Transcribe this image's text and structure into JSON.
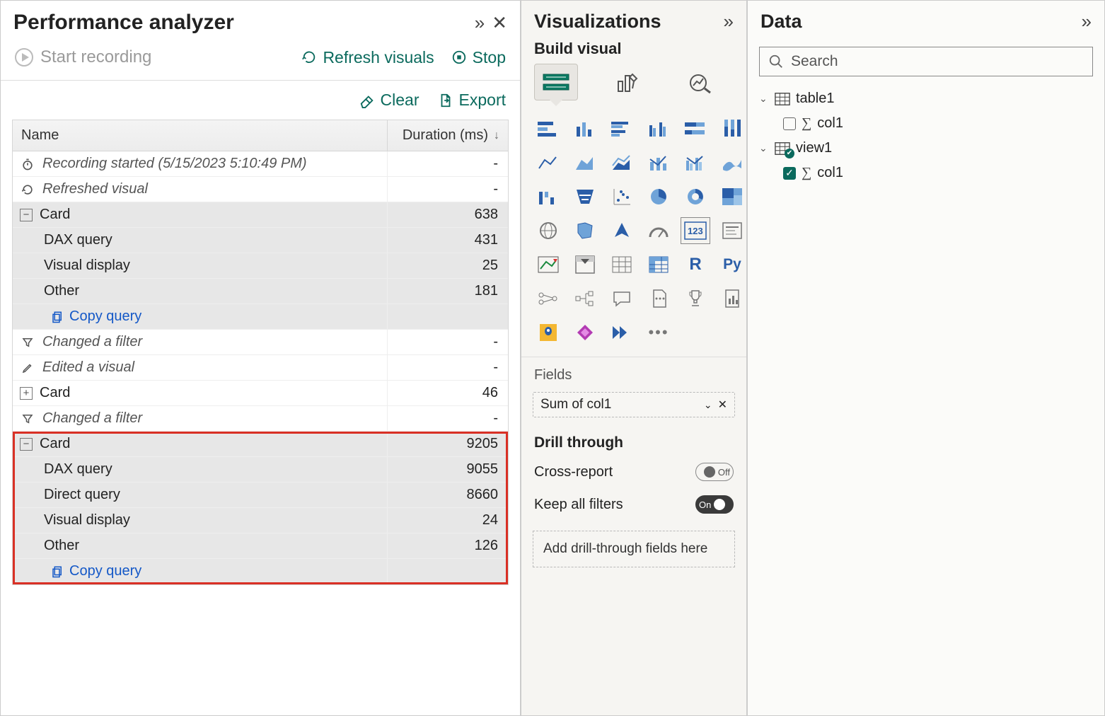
{
  "perf": {
    "title": "Performance analyzer",
    "start": "Start recording",
    "refresh": "Refresh visuals",
    "stop": "Stop",
    "clear": "Clear",
    "export": "Export",
    "col_name": "Name",
    "col_dur": "Duration (ms)",
    "rows": {
      "rec_started": "Recording started (5/15/2023 5:10:49 PM)",
      "refreshed": "Refreshed visual",
      "card1": "Card",
      "card1_dur": "638",
      "dax1": "DAX query",
      "dax1_dur": "431",
      "vis1": "Visual display",
      "vis1_dur": "25",
      "oth1": "Other",
      "oth1_dur": "181",
      "copy": "Copy query",
      "chg_filter1": "Changed a filter",
      "edited": "Edited a visual",
      "card2": "Card",
      "card2_dur": "46",
      "chg_filter2": "Changed a filter",
      "card3": "Card",
      "card3_dur": "9205",
      "dax3": "DAX query",
      "dax3_dur": "9055",
      "dq3": "Direct query",
      "dq3_dur": "8660",
      "vis3": "Visual display",
      "vis3_dur": "24",
      "oth3": "Other",
      "oth3_dur": "126",
      "dash": "-"
    }
  },
  "viz": {
    "title": "Visualizations",
    "build": "Build visual",
    "fields": "Fields",
    "field_pill": "Sum of col1",
    "drill": "Drill through",
    "cross": "Cross-report",
    "keep": "Keep all filters",
    "off": "Off",
    "on": "On",
    "drop": "Add drill-through fields here"
  },
  "data": {
    "title": "Data",
    "search": "Search",
    "table1": "table1",
    "col1": "col1",
    "view1": "view1"
  }
}
